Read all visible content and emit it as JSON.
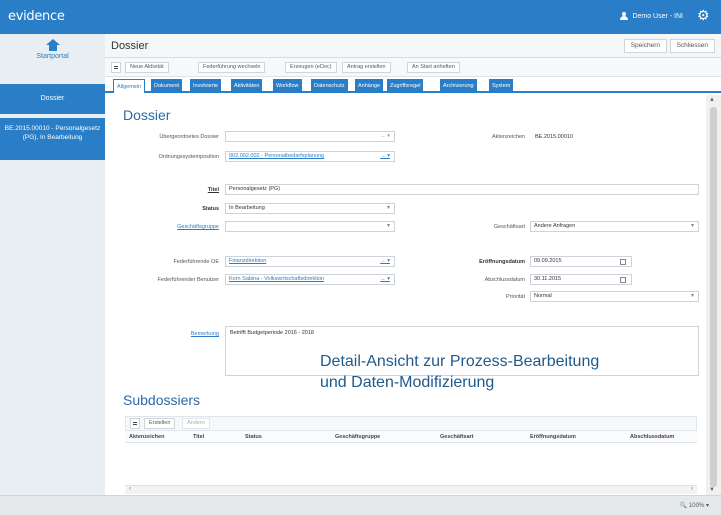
{
  "app": {
    "logo": "evidence",
    "user": "Demo User - INI"
  },
  "leftnav": {
    "start_label": "Startportal",
    "dossier_label": "Dossier",
    "item_label": "BE.2015.00010 - Personalgesetz (PG), In Bearbeitung"
  },
  "header": {
    "title": "Dossier",
    "save_label": "Speichern",
    "close_label": "Schliessen"
  },
  "toolbar": {
    "buttons": [
      "Neue Aktivität",
      "Federführung wechseln",
      "Erzeugen (eDoc)",
      "Antrag erstellen",
      "An Start anheften"
    ]
  },
  "tabs": [
    "Allgemein",
    "Dokument",
    "Involvierte",
    "Aktivitäten",
    "Workflow",
    "Datenschutz",
    "Anhänge",
    "Zugriffsregel",
    "Archivierung",
    "System"
  ],
  "form": {
    "section_title": "Dossier",
    "uebergeordnet_label": "Übergeordnetes Dossier",
    "uebergeordnet_value": "",
    "aktenzeichen_label": "Aktenzeichen",
    "aktenzeichen_value": "BE.2015.00010",
    "ordnung_label": "Ordnungssystemposition",
    "ordnung_value": "002.002.002 - Personalbedarfsplanung",
    "titel_label": "Titel",
    "titel_value": "Personalgesetz (PG)",
    "status_label": "Status",
    "status_value": "In Bearbeitung",
    "geschaeftsgruppe_label": "Geschäftsgruppe",
    "geschaeftsgruppe_value": "",
    "geschaeftsart_label": "Geschäftsart",
    "geschaeftsart_value": "Andere Anfragen",
    "oe_label": "Federführende OE",
    "oe_value": "Finanzdirektion",
    "benutzer_label": "Federführender Benutzer",
    "benutzer_value": "Korn Sabina - Volkswirtschaftsdirektion",
    "eroeffnung_label": "Eröffnungsdatum",
    "eroeffnung_value": "09.09.2015",
    "abschluss_label": "Abschlussdatum",
    "abschluss_value": "30.11.2015",
    "prioritaet_label": "Priorität",
    "prioritaet_value": "Normal",
    "bemerkung_label": "Bemerkung",
    "bemerkung_value": "Betrifft Budgetperiode 2016 - 2018",
    "overlay_line1": "Detail-Ansicht zur Prozess-Bearbeitung",
    "overlay_line2": "und Daten-Modifizierung"
  },
  "subdossiers": {
    "title": "Subdossiers",
    "create_label": "Erstellen",
    "change_label": "Ändern",
    "columns": [
      "Aktenzeichen",
      "Titel",
      "Status",
      "Geschäftsgruppe",
      "Geschäftsart",
      "Eröffnungsdatum",
      "Abschlussdatum"
    ]
  },
  "statusbar": {
    "zoom": "100%"
  },
  "colors": {
    "accent": "#2a7ec7"
  },
  "icons": [
    "home-icon",
    "user-icon",
    "gear-icon",
    "menu-icon",
    "arrow-right-icon",
    "chevron-down-icon",
    "calendar-icon"
  ]
}
